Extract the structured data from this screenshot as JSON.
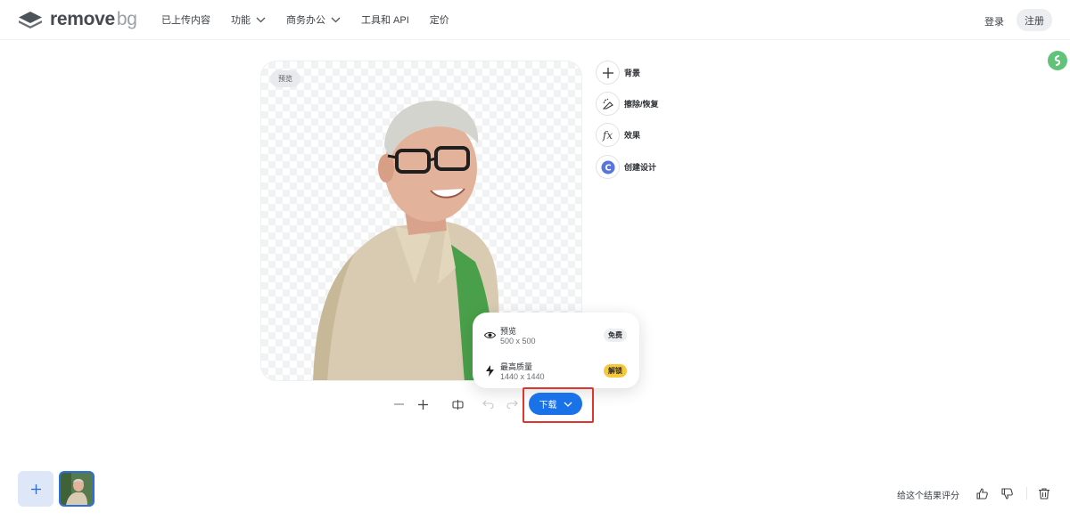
{
  "header": {
    "logo": {
      "word1": "remove",
      "word2": "bg"
    },
    "nav": [
      {
        "label": "已上传内容",
        "has_dropdown": false
      },
      {
        "label": "功能",
        "has_dropdown": true
      },
      {
        "label": "商务办公",
        "has_dropdown": true
      },
      {
        "label": "工具和 API",
        "has_dropdown": false
      },
      {
        "label": "定价",
        "has_dropdown": false
      }
    ],
    "login": "登录",
    "signup": "注册"
  },
  "preview": {
    "tag": "预览"
  },
  "tools": [
    {
      "label": "背景",
      "icon": "plus-icon"
    },
    {
      "label": "擦除/恢复",
      "icon": "eraser-icon"
    },
    {
      "label": "效果",
      "icon": "fx-icon"
    },
    {
      "label": "创建设计",
      "icon": "canva-icon"
    }
  ],
  "download_menu": {
    "options": [
      {
        "title": "预览",
        "size": "500 x 500",
        "badge": "免费",
        "icon": "eye-icon"
      },
      {
        "title": "最高质量",
        "size": "1440 x 1440",
        "badge": "解锁",
        "icon": "bolt-icon"
      }
    ],
    "button_label": "下载"
  },
  "bottom": {
    "rate_text": "给这个结果评分"
  },
  "colors": {
    "accent": "#1a72e8",
    "highlight": "#e0352b",
    "unlock_badge": "#f7c93a"
  }
}
